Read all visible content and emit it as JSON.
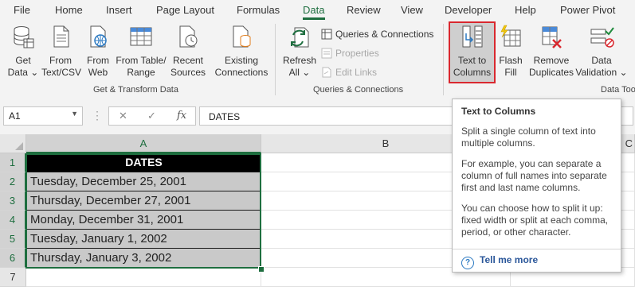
{
  "tabs": [
    "File",
    "Home",
    "Insert",
    "Page Layout",
    "Formulas",
    "Data",
    "Review",
    "View",
    "Developer",
    "Help",
    "Power Pivot"
  ],
  "active_tab": "Data",
  "ribbon": {
    "get_data": [
      "Get",
      "Data ⌄"
    ],
    "from_text_csv": [
      "From",
      "Text/CSV"
    ],
    "from_web": [
      "From",
      "Web"
    ],
    "from_table_range": [
      "From Table/",
      "Range"
    ],
    "recent_sources": [
      "Recent",
      "Sources"
    ],
    "existing_connections": [
      "Existing",
      "Connections"
    ],
    "group_get_transform": "Get & Transform Data",
    "refresh_all": [
      "Refresh",
      "All ⌄"
    ],
    "queries_connections": "Queries & Connections",
    "properties": "Properties",
    "edit_links": "Edit Links",
    "group_queries": "Queries & Connections",
    "text_to_columns": [
      "Text to",
      "Columns"
    ],
    "flash_fill": [
      "Flash",
      "Fill"
    ],
    "remove_duplicates": [
      "Remove",
      "Duplicates"
    ],
    "data_validation": [
      "Data",
      "Validation ⌄"
    ],
    "group_data_tools": "Data Too"
  },
  "formula_bar": {
    "name_box": "A1",
    "cancel": "✕",
    "enter": "✓",
    "fx": "fx",
    "formula": "DATES"
  },
  "grid": {
    "columns": [
      "A",
      "B",
      "C"
    ],
    "rows": [
      "1",
      "2",
      "3",
      "4",
      "5",
      "6",
      "7"
    ],
    "cells": [
      "DATES",
      "Tuesday, December 25, 2001",
      "Thursday, December 27, 2001",
      "Monday, December 31, 2001",
      "Tuesday, January 1, 2002",
      "Thursday, January 3, 2002"
    ]
  },
  "tooltip": {
    "title": "Text to Columns",
    "p1": "Split a single column of text into multiple columns.",
    "p2": "For example, you can separate a column of full names into separate first and last name columns.",
    "p3": "You can choose how to split it up: fixed width or split at each comma, period, or other character.",
    "link": "Tell me more"
  },
  "colors": {
    "accent": "#1e6e3f",
    "highlight_border": "#d9282f",
    "link": "#2b579a"
  }
}
